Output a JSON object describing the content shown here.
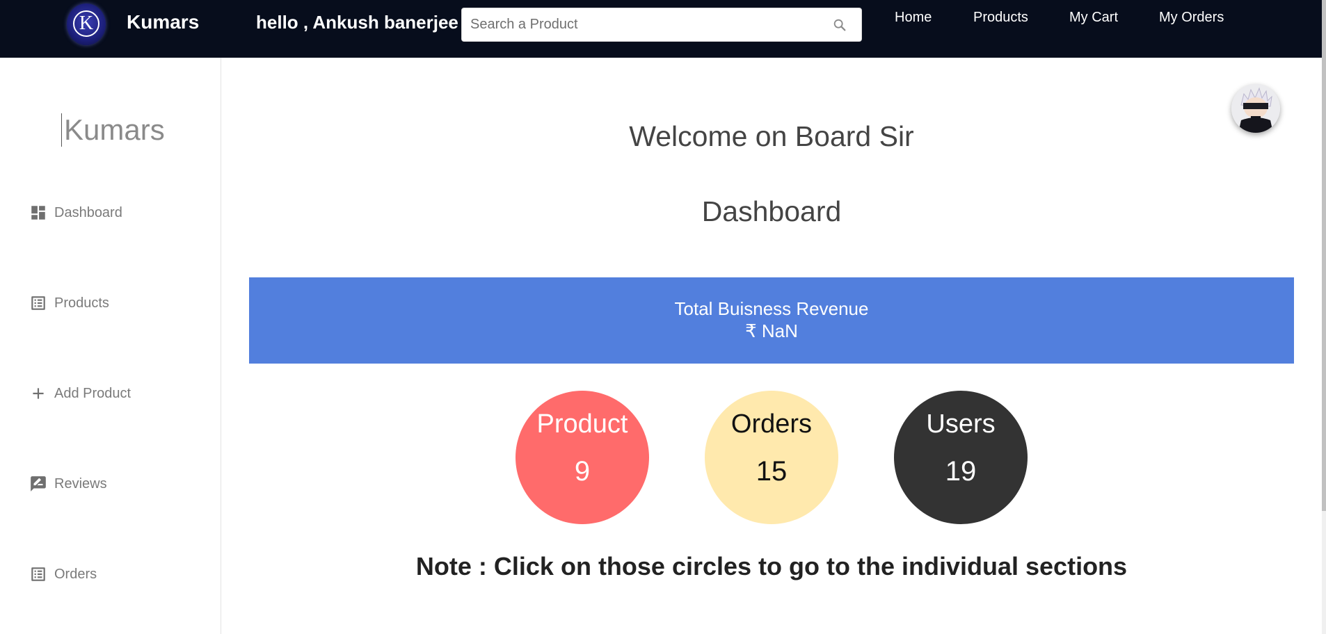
{
  "navbar": {
    "logo_letter": "K",
    "brand": "Kumars",
    "greeting": "hello , Ankush banerjee",
    "search": {
      "placeholder": "Search a Product",
      "value": ""
    },
    "links": [
      "Home",
      "Products",
      "My Cart",
      "My Orders"
    ],
    "background": "#070d1c"
  },
  "sidebar": {
    "brand": "Kumars",
    "items": [
      {
        "label": "Dashboard",
        "icon": "dashboard-icon"
      },
      {
        "label": "Products",
        "icon": "list-icon"
      },
      {
        "label": "Add Product",
        "icon": "add-icon"
      },
      {
        "label": "Reviews",
        "icon": "rate-review-icon"
      },
      {
        "label": "Orders",
        "icon": "list-icon"
      }
    ]
  },
  "main": {
    "welcome": "Welcome on Board Sir",
    "title": "Dashboard",
    "revenue": {
      "label": "Total Buisness Revenue",
      "value": "₹ NaN",
      "color": "#527fdd"
    },
    "stats": [
      {
        "title": "Product",
        "count": "9",
        "color": "#ff6b6b",
        "text_color": "#ffffff"
      },
      {
        "title": "Orders",
        "count": "15",
        "color": "#ffe9ad",
        "text_color": "#111111"
      },
      {
        "title": "Users",
        "count": "19",
        "color": "#333333",
        "text_color": "#ffffff"
      }
    ],
    "note": "Note : Click on those circles to go to the individual sections"
  }
}
